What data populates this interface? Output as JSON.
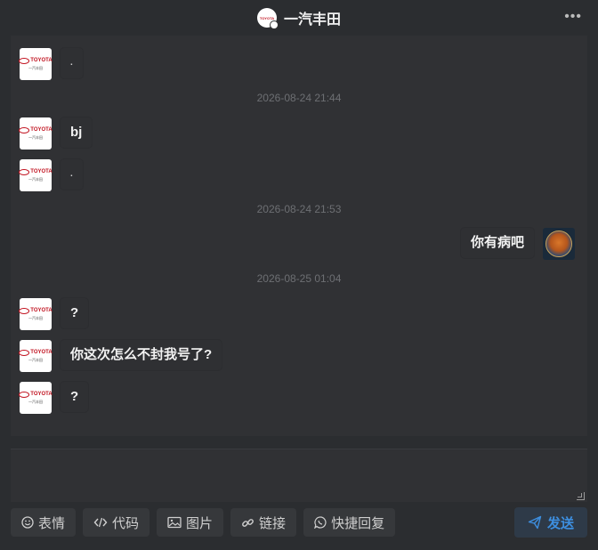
{
  "header": {
    "title": "一汽丰田",
    "more_icon": "more-horizontal-icon",
    "avatar_text": "TOYOTA"
  },
  "avatar": {
    "brand": "TOYOTA",
    "sub": "一汽丰田"
  },
  "messages": [
    {
      "side": "left",
      "text": "."
    },
    {
      "type": "time",
      "text": "2026-08-24 21:44"
    },
    {
      "side": "left",
      "text": "bj"
    },
    {
      "side": "left",
      "text": "."
    },
    {
      "type": "time",
      "text": "2026-08-24 21:53"
    },
    {
      "side": "right",
      "text": "你有病吧"
    },
    {
      "type": "time",
      "text": "2026-08-25 01:04"
    },
    {
      "side": "left",
      "text": "?"
    },
    {
      "side": "left",
      "text": "你这次怎么不封我号了?"
    },
    {
      "side": "left",
      "text": "?"
    }
  ],
  "toolbar": {
    "emoji_label": "表情",
    "code_label": "代码",
    "image_label": "图片",
    "link_label": "链接",
    "quick_reply_label": "快捷回复",
    "send_label": "发送"
  },
  "colors": {
    "background": "#2b2d30",
    "panel": "#303134",
    "send_accent": "#3d8fe0",
    "timestamp": "#6d6f73"
  }
}
